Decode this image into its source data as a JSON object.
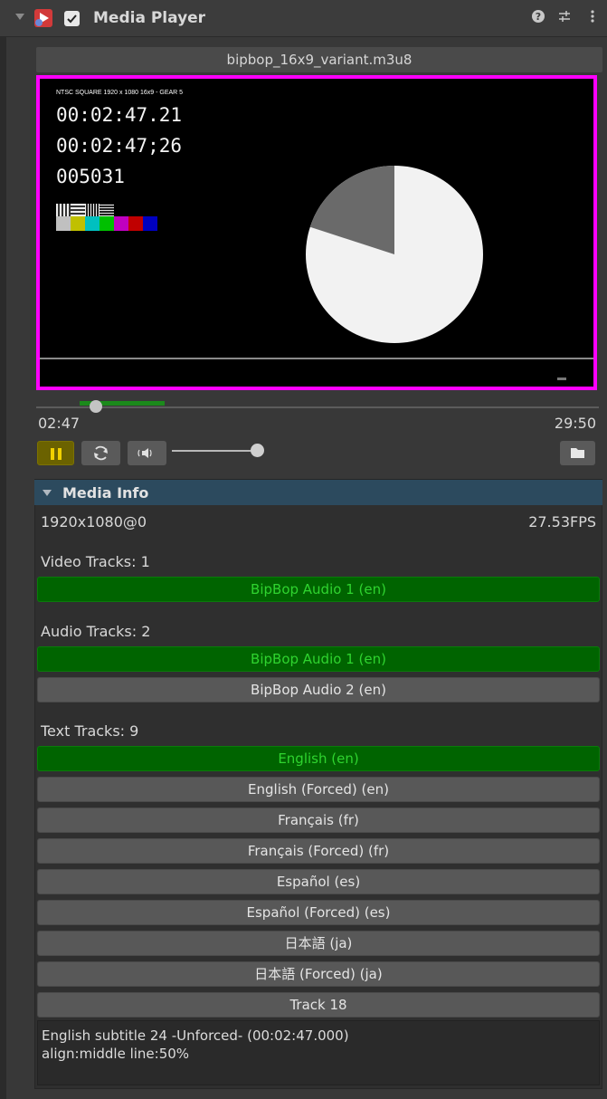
{
  "header": {
    "title": "Media Player"
  },
  "source": {
    "file": "bipbop_16x9_variant.m3u8"
  },
  "video_overlay": {
    "format_line": "NTSC SQUARE  1920 x 1080  16x9  -  GEAR 5",
    "timecode1": "00:02:47.21",
    "timecode2": "00:02:47;26",
    "frame": "005031",
    "pie_dark_fraction": 0.2
  },
  "playback": {
    "current": "02:47",
    "duration": "29:50",
    "progress": 0.056,
    "buffered_end": 0.091,
    "volume": 1.0
  },
  "media_info": {
    "title": "Media Info",
    "resolution": "1920x1080@0",
    "fps": "27.53FPS",
    "video_tracks_label": "Video Tracks: 1",
    "video_tracks": [
      {
        "label": "BipBop Audio 1 (en)",
        "active": true
      }
    ],
    "audio_tracks_label": "Audio Tracks: 2",
    "audio_tracks": [
      {
        "label": "BipBop Audio 1 (en)",
        "active": true
      },
      {
        "label": "BipBop Audio 2 (en)",
        "active": false
      }
    ],
    "text_tracks_label": "Text Tracks: 9",
    "text_tracks": [
      {
        "label": "English (en)",
        "active": true
      },
      {
        "label": "English (Forced) (en)",
        "active": false
      },
      {
        "label": "Français (fr)",
        "active": false
      },
      {
        "label": "Français (Forced) (fr)",
        "active": false
      },
      {
        "label": "Español (es)",
        "active": false
      },
      {
        "label": "Español (Forced) (es)",
        "active": false
      },
      {
        "label": "日本語 (ja)",
        "active": false
      },
      {
        "label": "日本語 (Forced) (ja)",
        "active": false
      },
      {
        "label": "Track 18",
        "active": false
      }
    ],
    "subtitle_line1": "English subtitle 24 -Unforced- (00:02:47.000)",
    "subtitle_line2": "align:middle line:50%"
  },
  "colors": {
    "highlight": "#ff00ff",
    "active_track": "#006400",
    "active_text": "#2fd42f"
  },
  "icons": {
    "help": "help-icon",
    "presets": "presets-icon",
    "menu": "kebab-menu-icon",
    "pause": "pause-icon",
    "loop": "loop-icon",
    "audio": "speaker-icon",
    "folder": "folder-icon"
  }
}
